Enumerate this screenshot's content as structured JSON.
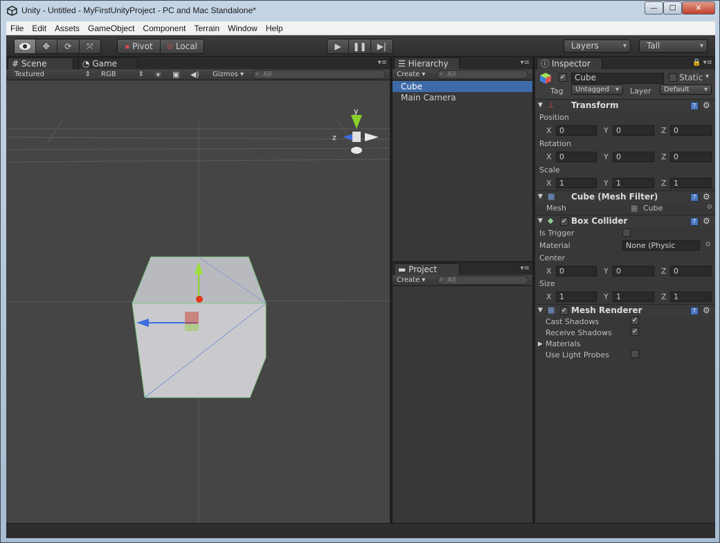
{
  "window": {
    "title": "Unity - Untitled - MyFirstUnityProject - PC and Mac Standalone*",
    "min": "—",
    "max": "☐",
    "close": "✕"
  },
  "menu": [
    "File",
    "Edit",
    "Assets",
    "GameObject",
    "Component",
    "Terrain",
    "Window",
    "Help"
  ],
  "toolbar": {
    "pivot": "Pivot",
    "local": "Local",
    "layers": "Layers",
    "layout": "Tall"
  },
  "scene": {
    "tab_scene": "Scene",
    "tab_game": "Game",
    "render_mode": "Textured",
    "color_mode": "RGB",
    "gizmos": "Gizmos",
    "search_placeholder": "All",
    "gizmo_y": "y",
    "gizmo_z": "z"
  },
  "hierarchy": {
    "tab": "Hierarchy",
    "create": "Create",
    "search_placeholder": "All",
    "items": [
      "Cube",
      "Main Camera"
    ],
    "selected": "Cube"
  },
  "project": {
    "tab": "Project",
    "create": "Create",
    "search_placeholder": "All"
  },
  "inspector": {
    "tab": "Inspector",
    "object_name": "Cube",
    "static_label": "Static",
    "tag_label": "Tag",
    "tag_value": "Untagged",
    "layer_label": "Layer",
    "layer_value": "Default",
    "transform": {
      "title": "Transform",
      "position_label": "Position",
      "position": {
        "x": "0",
        "y": "0",
        "z": "0"
      },
      "rotation_label": "Rotation",
      "rotation": {
        "x": "0",
        "y": "0",
        "z": "0"
      },
      "scale_label": "Scale",
      "scale": {
        "x": "1",
        "y": "1",
        "z": "1"
      }
    },
    "mesh_filter": {
      "title": "Cube (Mesh Filter)",
      "mesh_label": "Mesh",
      "mesh_value": "Cube"
    },
    "box_collider": {
      "title": "Box Collider",
      "is_trigger_label": "Is Trigger",
      "material_label": "Material",
      "material_value": "None (Physic Mater",
      "center_label": "Center",
      "center": {
        "x": "0",
        "y": "0",
        "z": "0"
      },
      "size_label": "Size",
      "size": {
        "x": "1",
        "y": "1",
        "z": "1"
      }
    },
    "mesh_renderer": {
      "title": "Mesh Renderer",
      "cast_shadows_label": "Cast Shadows",
      "cast_shadows": true,
      "receive_shadows_label": "Receive Shadows",
      "receive_shadows": true,
      "materials_label": "Materials",
      "light_probes_label": "Use Light Probes",
      "light_probes": false
    },
    "axis_labels": {
      "x": "X",
      "y": "Y",
      "z": "Z"
    }
  },
  "colors": {
    "selection": "#3e6ba8",
    "scene_bg": "#454545",
    "cube_face": "#c8c8cc"
  }
}
